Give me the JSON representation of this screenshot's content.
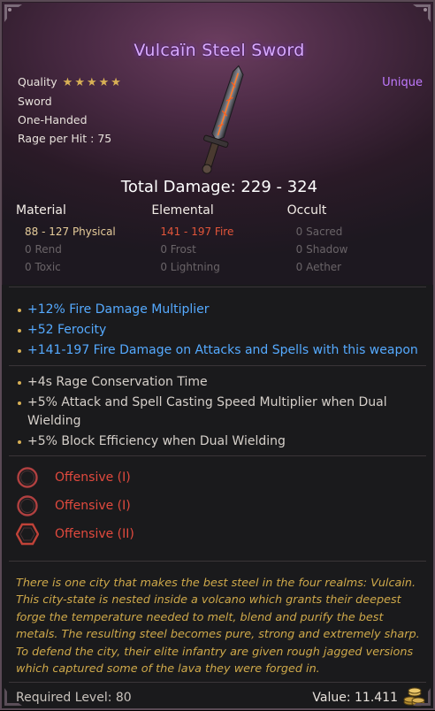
{
  "item": {
    "name": "Vulcaïn Steel Sword",
    "rarity": "Unique",
    "quality_label": "Quality",
    "quality_stars": 5,
    "quality_stars_text": "★★★★★",
    "type": "Sword",
    "handedness": "One-Handed",
    "rage_per_hit": "Rage per Hit : 75",
    "total_damage": "Total Damage: 229 - 324"
  },
  "damage": {
    "headers": [
      "Material",
      "Elemental",
      "Occult"
    ],
    "rows": [
      [
        "88 - 127  Physical",
        "141 - 197  Fire",
        "0  Sacred"
      ],
      [
        "0  Rend",
        "0  Frost",
        "0  Shadow"
      ],
      [
        "0  Toxic",
        "0  Lightning",
        "0  Aether"
      ]
    ]
  },
  "unique_mods": [
    "+12% Fire Damage Multiplier",
    "+52 Ferocity",
    "+141-197 Fire Damage on Attacks and Spells with this weapon"
  ],
  "base_mods": [
    "+4s Rage Conservation Time",
    "+5% Attack and Spell Casting Speed Multiplier when Dual Wielding",
    "+5% Block Efficiency when Dual Wielding"
  ],
  "sockets": [
    {
      "label": "Offensive (I)",
      "shape": "circle-socket-icon"
    },
    {
      "label": "Offensive (I)",
      "shape": "circle-socket-icon"
    },
    {
      "label": "Offensive (II)",
      "shape": "hexagon-socket-icon"
    }
  ],
  "lore": "There is one city that makes the best steel in the four realms: Vulcain. This city-state is nested inside a volcano which grants their deepest forge the temperature needed to melt, blend and purify the best metals. The resulting steel becomes pure, strong and extremely sharp. To defend the city, their elite infantry are given rough jagged versions which captured some of the lava they were forged in.",
  "footer": {
    "required_level": "Required Level: 80",
    "value": "Value: 11.411"
  },
  "colors": {
    "title": "#d9aaff",
    "rarity": "#c07aff",
    "magic_mod": "#55aaff",
    "fire": "#e2553a",
    "lore": "#cfa94a",
    "socket": "#e24a3e"
  }
}
